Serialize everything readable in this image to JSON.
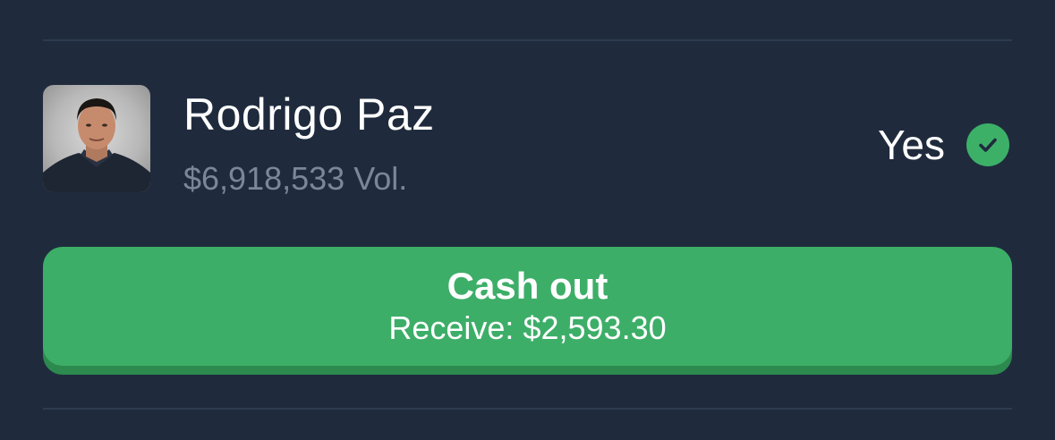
{
  "market_row": {
    "candidate_name": "Rodrigo Paz",
    "volume_amount": "$6,918,533",
    "volume_suffix": "Vol.",
    "outcome_label": "Yes",
    "outcome_icon": "check-circle-icon",
    "outcome_color": "#3db068"
  },
  "cashout": {
    "title": "Cash out",
    "receive_label": "Receive:",
    "receive_amount": "$2,593.30",
    "button_color": "#3dae68"
  },
  "theme": {
    "background": "#1f2b3d",
    "divider": "#2d3b50",
    "muted_text": "#7b8798"
  }
}
